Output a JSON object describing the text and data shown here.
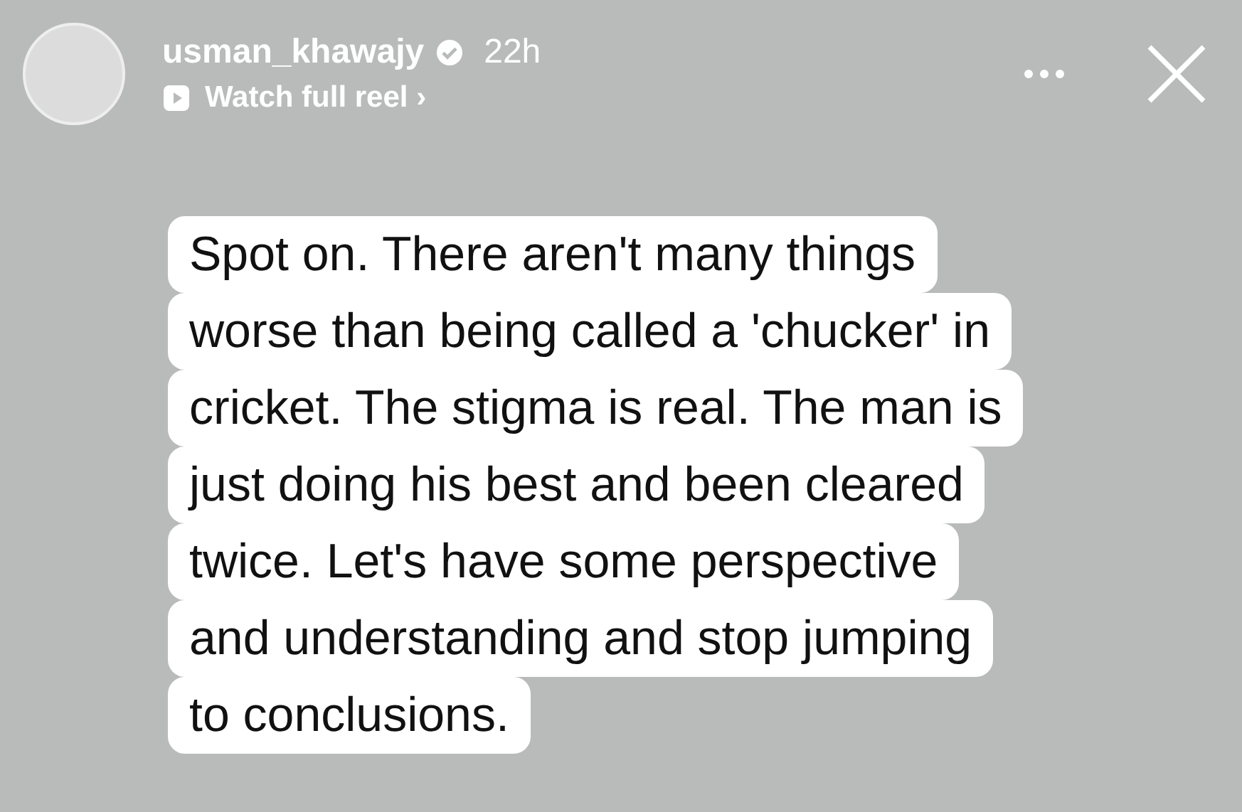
{
  "header": {
    "username": "usman_khawajy",
    "verified": true,
    "time": "22h",
    "reel_link": "Watch full reel ›"
  },
  "caption_lines": [
    "Spot on. There aren't many things",
    "worse than being called a 'chucker' in",
    "cricket. The stigma is real. The man is",
    "just doing his best and been cleared",
    "twice. Let's have some perspective",
    "and understanding and stop jumping",
    "to conclusions."
  ]
}
